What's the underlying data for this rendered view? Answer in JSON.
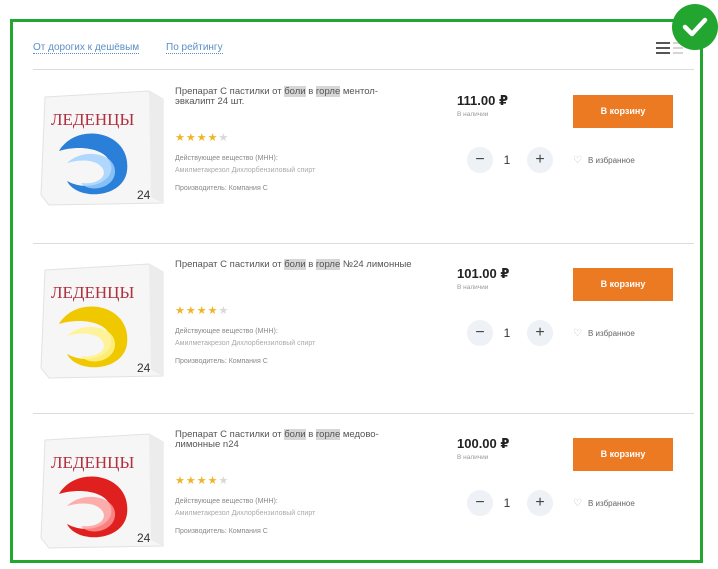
{
  "sort": {
    "cheap_label": "От дорогих к дешёвым",
    "rating_label": "По рейтингу"
  },
  "products": [
    {
      "brand": "ЛЕДЕНЦЫ",
      "pack_count": "24",
      "swirl_color": "#2a7fd8",
      "title_pre": "Препарат С пастилки от ",
      "title_hl1": "боли",
      "title_mid": " в ",
      "title_hl2": "горле",
      "title_post": " ментол-эвкалипт 24 шт.",
      "rating": "★★★★",
      "rating_off": "★",
      "ingredient_label": "Действующее вещество (МНН):",
      "ingredient_value": "Амилметакрезол Дихлорбензиловый спирт",
      "manufacturer": "Производитель: Компания С",
      "price": "111.00 ₽",
      "stock": "В наличии",
      "qty": "1",
      "cart_label": "В корзину",
      "fav_label": "В избранное"
    },
    {
      "brand": "ЛЕДЕНЦЫ",
      "pack_count": "24",
      "swirl_color": "#f0c800",
      "title_pre": "Препарат С пастилки от ",
      "title_hl1": "боли",
      "title_mid": " в ",
      "title_hl2": "горле",
      "title_post": " №24 лимонные",
      "rating": "★★★★",
      "rating_off": "★",
      "ingredient_label": "Действующее вещество (МНН):",
      "ingredient_value": "Амилметакрезол Дихлорбензиловый спирт",
      "manufacturer": "Производитель: Компания С",
      "price": "101.00 ₽",
      "stock": "В наличии",
      "qty": "1",
      "cart_label": "В корзину",
      "fav_label": "В избранное"
    },
    {
      "brand": "ЛЕДЕНЦЫ",
      "pack_count": "24",
      "swirl_color": "#e0201e",
      "title_pre": "Препарат С пастилки от ",
      "title_hl1": "боли",
      "title_mid": " в ",
      "title_hl2": "горле",
      "title_post": " медово-лимонные n24",
      "rating": "★★★★",
      "rating_off": "★",
      "ingredient_label": "Действующее вещество (МНН):",
      "ingredient_value": "Амилметакрезол Дихлорбензиловый спирт",
      "manufacturer": "Производитель: Компания С",
      "price": "100.00 ₽",
      "stock": "В наличии",
      "qty": "1",
      "cart_label": "В корзину",
      "fav_label": "В избранное"
    }
  ],
  "colors": {
    "frame": "#22a630",
    "cart_button": "#ec7a23",
    "link": "#5b8fc4",
    "star": "#f0b429"
  },
  "icons": [
    "check-icon",
    "menu-icon",
    "minus-icon",
    "plus-icon",
    "heart-icon"
  ]
}
